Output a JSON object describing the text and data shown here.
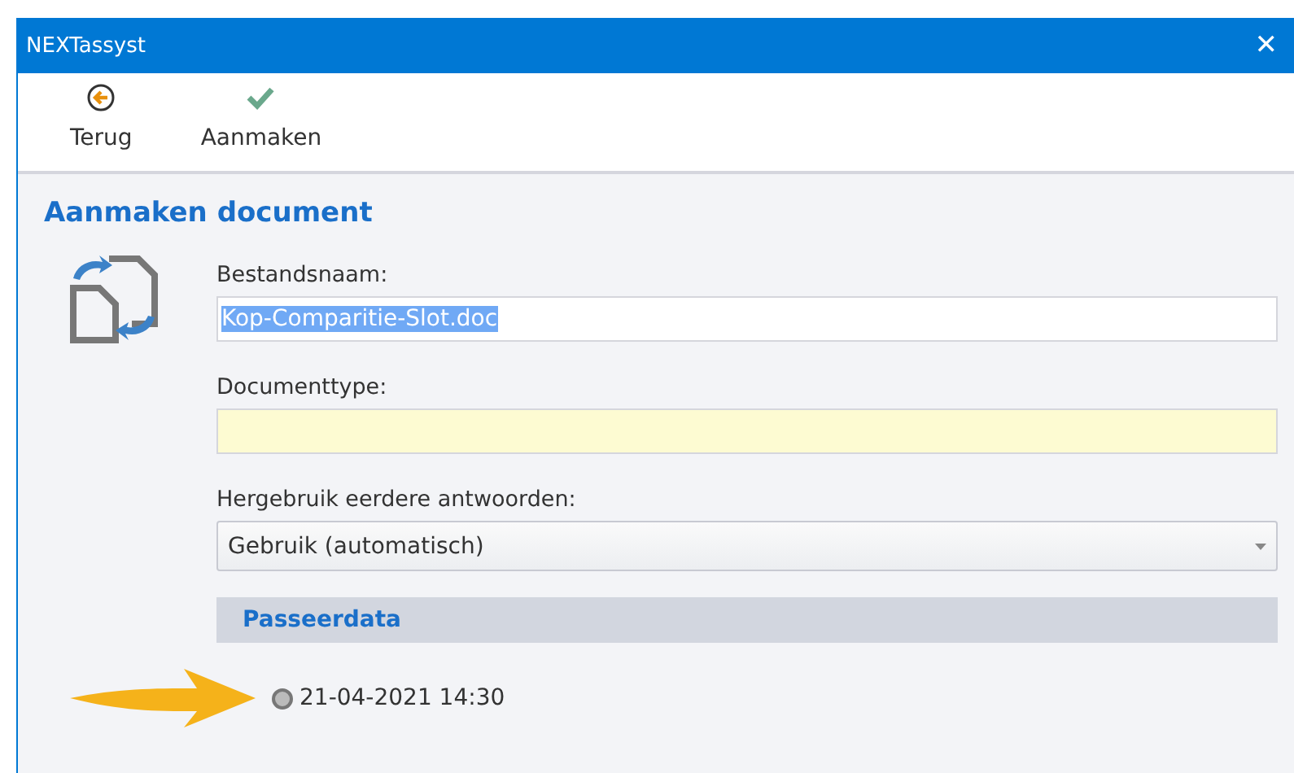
{
  "window": {
    "title": "NEXTassyst",
    "close": "✕"
  },
  "toolbar": [
    {
      "kind": "back",
      "label": "Terug"
    },
    {
      "kind": "confirm",
      "label": "Aanmaken"
    }
  ],
  "heading": "Aanmaken document",
  "fields": [
    {
      "kind": "text",
      "label": "Bestandsnaam:",
      "value": "Kop-Comparitie-Slot.doc",
      "highlighted": true
    },
    {
      "kind": "required",
      "label": "Documenttype:"
    },
    {
      "kind": "select",
      "label": "Hergebruik eerdere antwoorden:",
      "value": "Gebruik (automatisch)"
    }
  ],
  "section": {
    "title": "Passeerdata",
    "options": [
      {
        "label": "21-04-2021 14:30",
        "selected": true
      }
    ]
  }
}
